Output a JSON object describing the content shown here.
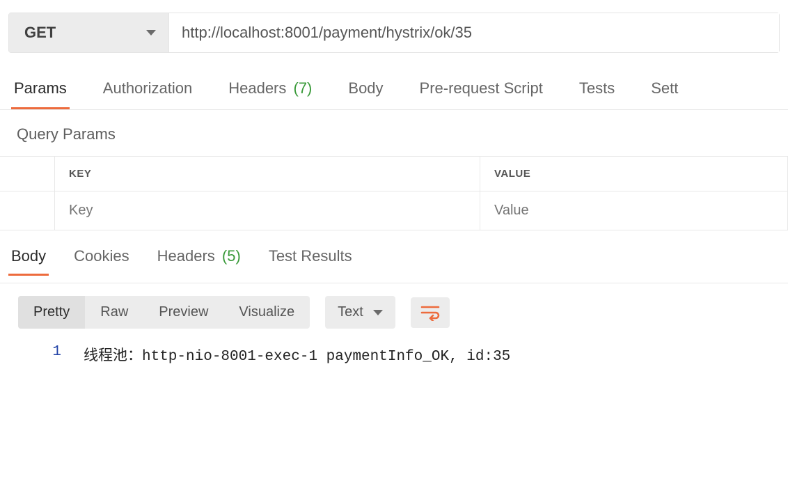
{
  "request": {
    "method": "GET",
    "url": "http://localhost:8001/payment/hystrix/ok/35"
  },
  "request_tabs": {
    "params": "Params",
    "authorization": "Authorization",
    "headers": "Headers",
    "headers_count": "(7)",
    "body": "Body",
    "prerequest": "Pre-request Script",
    "tests": "Tests",
    "settings": "Sett"
  },
  "query_params": {
    "title": "Query Params",
    "key_header": "KEY",
    "value_header": "VALUE",
    "key_placeholder": "Key",
    "value_placeholder": "Value"
  },
  "response_tabs": {
    "body": "Body",
    "cookies": "Cookies",
    "headers": "Headers",
    "headers_count": "(5)",
    "test_results": "Test Results"
  },
  "view_modes": {
    "pretty": "Pretty",
    "raw": "Raw",
    "preview": "Preview",
    "visualize": "Visualize",
    "language": "Text"
  },
  "response_body": {
    "line_no": "1",
    "text": "线程池：http-nio-8001-exec-1 paymentInfo_OK, id:35"
  }
}
